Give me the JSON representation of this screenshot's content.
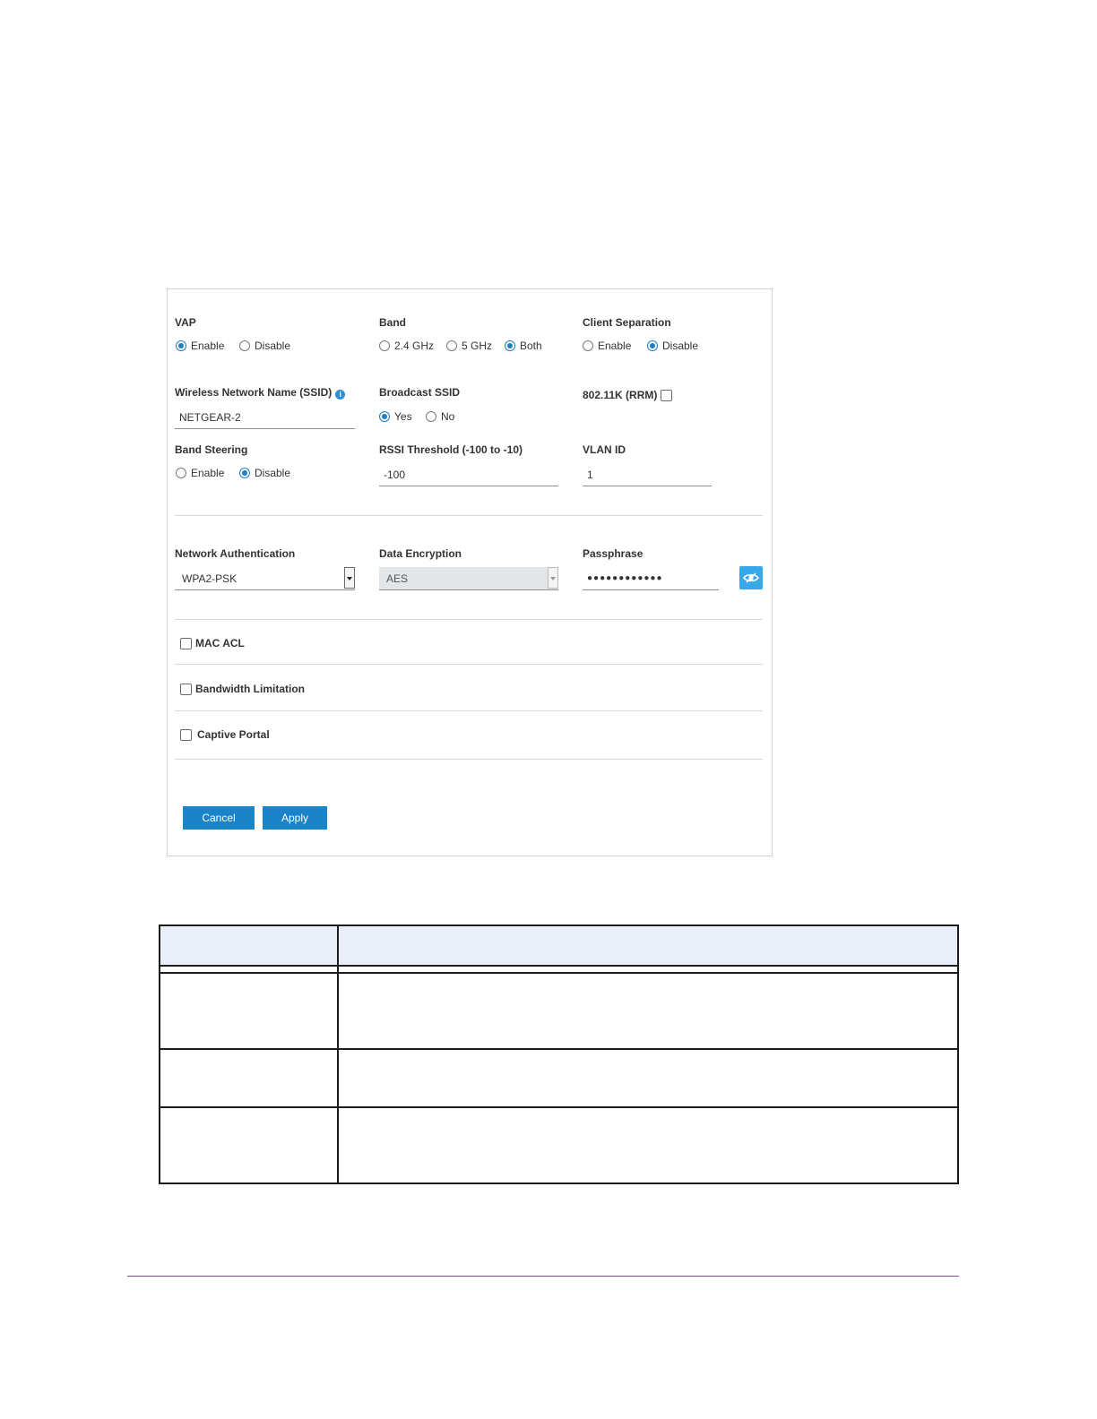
{
  "vap": {
    "label": "VAP",
    "enable": "Enable",
    "disable": "Disable",
    "selected": "Enable"
  },
  "band": {
    "label": "Band",
    "opt_24": "2.4 GHz",
    "opt_5": "5 GHz",
    "opt_both": "Both",
    "selected": "Both"
  },
  "client_separation": {
    "label": "Client Separation",
    "enable": "Enable",
    "disable": "Disable",
    "selected": "Disable"
  },
  "ssid": {
    "label": "Wireless Network Name (SSID)",
    "value": "NETGEAR-2"
  },
  "broadcast_ssid": {
    "label": "Broadcast SSID",
    "yes": "Yes",
    "no": "No",
    "selected": "Yes"
  },
  "rrm": {
    "label": "802.11K (RRM)",
    "checked": false
  },
  "band_steering": {
    "label": "Band Steering",
    "enable": "Enable",
    "disable": "Disable",
    "selected": "Disable"
  },
  "rssi": {
    "label": "RSSI Threshold (-100 to -10)",
    "value": "-100"
  },
  "vlan": {
    "label": "VLAN ID",
    "value": "1"
  },
  "network_auth": {
    "label": "Network Authentication",
    "value": "WPA2-PSK"
  },
  "data_encryption": {
    "label": "Data Encryption",
    "value": "AES"
  },
  "passphrase": {
    "label": "Passphrase",
    "value": "●●●●●●●●●●●●"
  },
  "mac_acl": {
    "label": "MAC ACL",
    "checked": false
  },
  "bandwidth_limitation": {
    "label": "Bandwidth Limitation",
    "checked": false
  },
  "captive_portal": {
    "label": "Captive Portal",
    "checked": false
  },
  "buttons": {
    "cancel": "Cancel",
    "apply": "Apply"
  },
  "colors": {
    "accent": "#1a84c6",
    "eye_button": "#37a9e8",
    "table_header": "#e9eef8",
    "footer_rule": "#7b4d86"
  },
  "icons": {
    "ssid_info": "info-icon",
    "show_passphrase": "eye-icon"
  }
}
